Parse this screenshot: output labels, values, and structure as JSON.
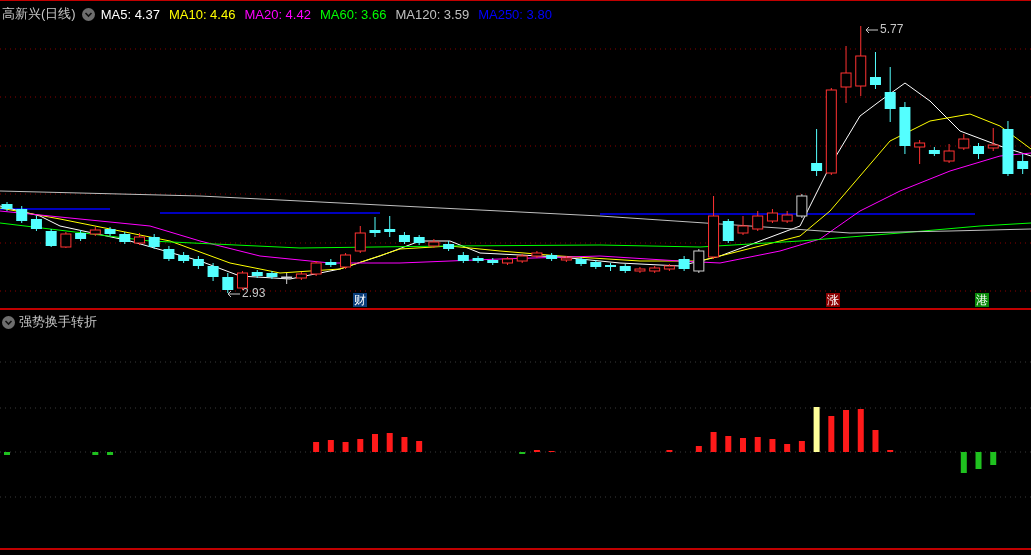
{
  "price_panel": {
    "title": "高新兴(日线)",
    "averages": [
      {
        "label": "MA5: 4.37",
        "color": "#ffffff"
      },
      {
        "label": "MA10: 4.46",
        "color": "#ffff00"
      },
      {
        "label": "MA20: 4.42",
        "color": "#ff00ff"
      },
      {
        "label": "MA60: 3.66",
        "color": "#00ff00"
      },
      {
        "label": "MA120: 3.59",
        "color": "#c0c0c0"
      },
      {
        "label": "MA250: 3.80",
        "color": "#0000ff"
      }
    ],
    "high_marker": "5.77",
    "low_marker": "2.93",
    "events": [
      {
        "label": "财",
        "color": "#0a3d7a"
      },
      {
        "label": "涨",
        "color": "#8b0000"
      },
      {
        "label": "港",
        "color": "#0a8a0a"
      }
    ]
  },
  "indicator_panel": {
    "title": "强势换手转折"
  }
}
